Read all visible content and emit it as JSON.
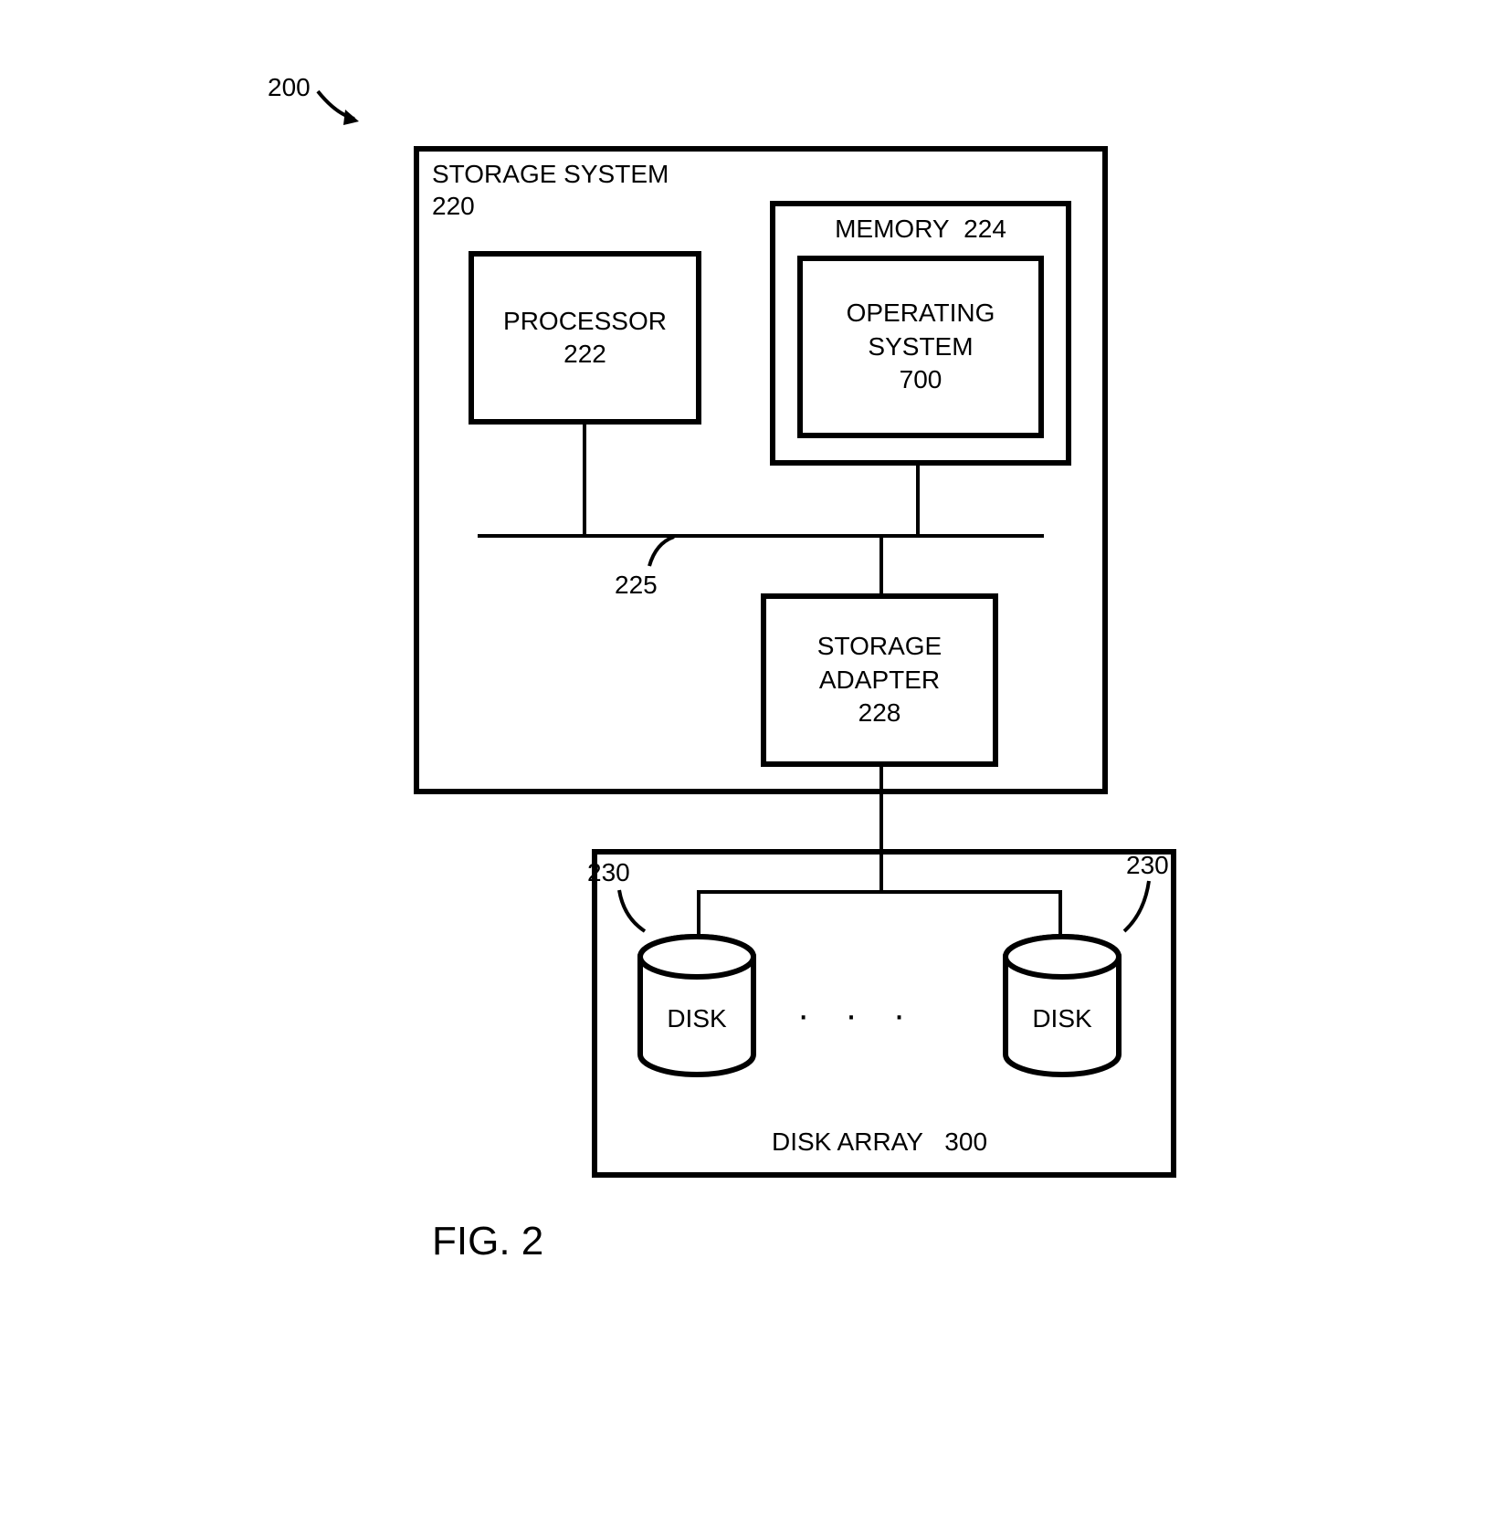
{
  "figure": {
    "ref": "200",
    "title": "FIG. 2"
  },
  "storageSystem": {
    "label": "STORAGE SYSTEM",
    "ref": "220"
  },
  "processor": {
    "label": "PROCESSOR",
    "ref": "222"
  },
  "memory": {
    "label": "MEMORY",
    "ref": "224"
  },
  "operatingSystem": {
    "label": "OPERATING SYSTEM",
    "ref": "700"
  },
  "bus": {
    "ref": "225"
  },
  "storageAdapter": {
    "label": "STORAGE ADAPTER",
    "ref": "228"
  },
  "diskArray": {
    "label": "DISK ARRAY",
    "ref": "300"
  },
  "disk": {
    "label": "DISK",
    "ref1": "230",
    "ref2": "230"
  }
}
